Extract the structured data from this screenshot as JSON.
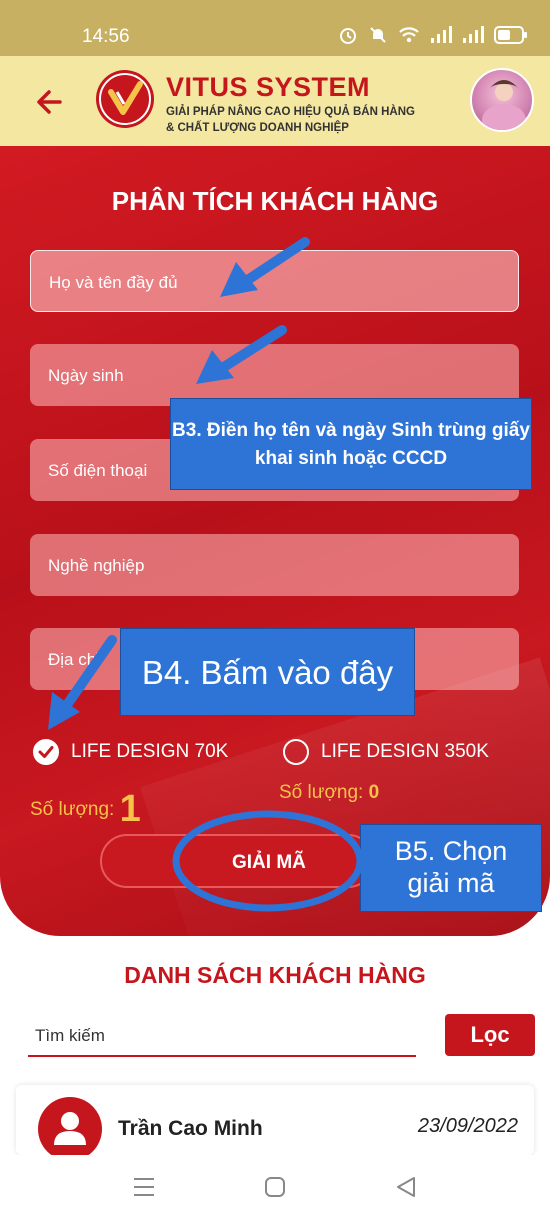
{
  "status_bar": {
    "time": "14:56"
  },
  "app_bar": {
    "brand_name": "VITUS SYSTEM",
    "tagline_1": "GIẢI PHÁP NÂNG CAO HIỆU QUẢ BÁN HÀNG",
    "tagline_2": "& CHẤT LƯỢNG DOANH NGHIỆP"
  },
  "form": {
    "title": "PHÂN TÍCH KHÁCH HÀNG",
    "full_name_placeholder": "Họ và tên đầy đủ",
    "birthdate_placeholder": "Ngày sinh",
    "phone_placeholder": "Số điện thoại",
    "job_placeholder": "Nghề nghiệp",
    "address_placeholder": "Địa chỉ",
    "option_1": {
      "label": "LIFE DESIGN 70K",
      "selected": true,
      "qty_label": "Số lượng:",
      "qty_value": "1"
    },
    "option_2": {
      "label": "LIFE DESIGN 350K",
      "selected": false,
      "qty_label": "Số lượng:",
      "qty_value": "0"
    },
    "decode_button": "GIẢI MÃ"
  },
  "annotations": {
    "b3": "B3. Điền họ tên và ngày Sinh trùng giấy khai sinh hoặc CCCD",
    "b4": "B4. Bấm vào đây",
    "b5_line1": "B5. Chọn",
    "b5_line2": "giải mã"
  },
  "customer_list": {
    "title": "DANH SÁCH KHÁCH HÀNG",
    "search_placeholder": "Tìm kiếm",
    "filter_button": "Lọc",
    "items": [
      {
        "name": "Trần Cao Minh",
        "date": "23/09/2022"
      }
    ]
  },
  "colors": {
    "brand_red": "#c4161c",
    "accent_yellow": "#f5c24a",
    "callout_blue": "#2e74d6"
  }
}
